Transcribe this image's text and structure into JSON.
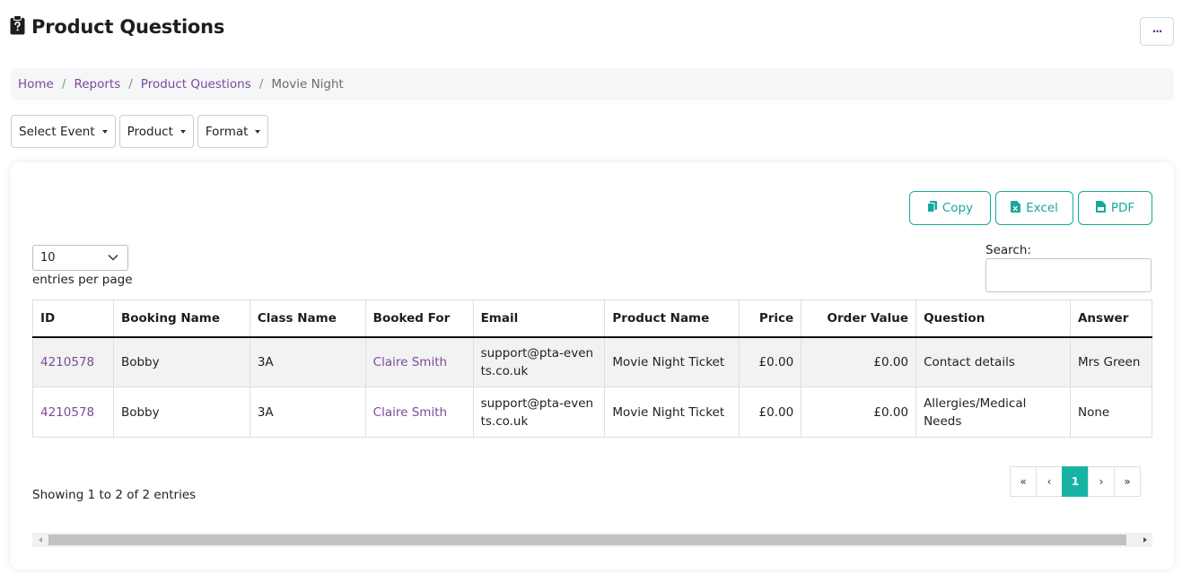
{
  "page": {
    "title": "Product Questions",
    "icon": "clipboard-question-icon",
    "more_label": "···"
  },
  "breadcrumb": [
    {
      "label": "Home"
    },
    {
      "label": "Reports"
    },
    {
      "label": "Product Questions"
    },
    {
      "label": "Movie Night"
    }
  ],
  "filters": {
    "event": "Select Event",
    "product": "Product",
    "format": "Format"
  },
  "export": {
    "copy": "Copy",
    "excel": "Excel",
    "pdf": "PDF"
  },
  "table_controls": {
    "page_length": "10",
    "page_length_label": "entries per page",
    "search_label": "Search:",
    "search_value": ""
  },
  "table": {
    "columns": [
      "ID",
      "Booking Name",
      "Class Name",
      "Booked For",
      "Email",
      "Product Name",
      "Price",
      "Order Value",
      "Question",
      "Answer"
    ],
    "rows": [
      {
        "id": "4210578",
        "booking_name": "Bobby",
        "class_name": "3A",
        "booked_for": "Claire Smith",
        "email": "support@pta-events.co.uk",
        "product_name": "Movie Night Ticket",
        "price": "£0.00",
        "order_value": "£0.00",
        "question": "Contact details",
        "answer": "Mrs Green"
      },
      {
        "id": "4210578",
        "booking_name": "Bobby",
        "class_name": "3A",
        "booked_for": "Claire Smith",
        "email": "support@pta-events.co.uk",
        "product_name": "Movie Night Ticket",
        "price": "£0.00",
        "order_value": "£0.00",
        "question": "Allergies/Medical Needs",
        "answer": "None"
      }
    ]
  },
  "info": "Showing 1 to 2 of 2 entries",
  "pagination": {
    "first": "«",
    "prev": "‹",
    "current": "1",
    "next": "›",
    "last": "»"
  },
  "colors": {
    "accent": "#18b3a3",
    "link": "#7d4a9b"
  }
}
